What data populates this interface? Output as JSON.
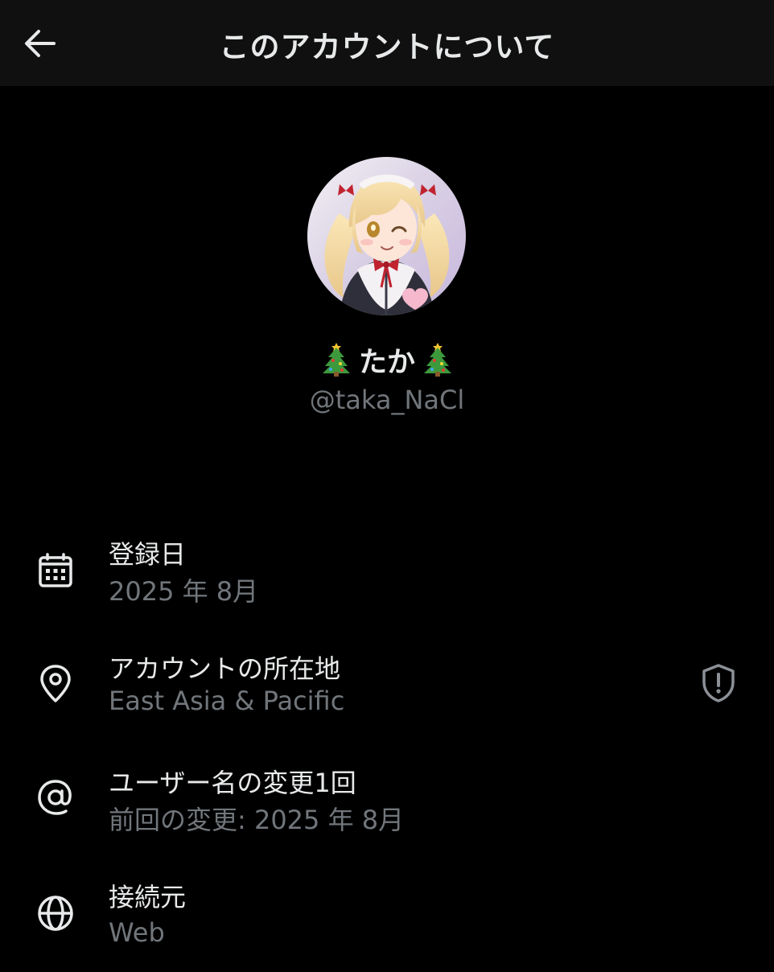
{
  "header": {
    "title": "このアカウントについて",
    "back_icon": "arrow-left-icon"
  },
  "profile": {
    "display_name": "たか",
    "name_emoji": "christmas-tree-icon",
    "handle": "@taka_NaCl",
    "avatar": "avatar-image"
  },
  "info": [
    {
      "icon": "calendar-icon",
      "label": "登録日",
      "value": "2025 年 8月"
    },
    {
      "icon": "location-pin-icon",
      "label": "アカウントの所在地",
      "value": "East Asia & Pacific",
      "action_icon": "shield-alert-icon"
    },
    {
      "icon": "at-sign-icon",
      "label": "ユーザー名の変更1回",
      "value": "前回の変更: 2025 年 8月"
    },
    {
      "icon": "globe-icon",
      "label": "接続元",
      "value": "Web"
    }
  ],
  "colors": {
    "background": "#000000",
    "header_background": "#101010",
    "primary_text": "#e7e9ea",
    "secondary_text": "#71767b"
  }
}
